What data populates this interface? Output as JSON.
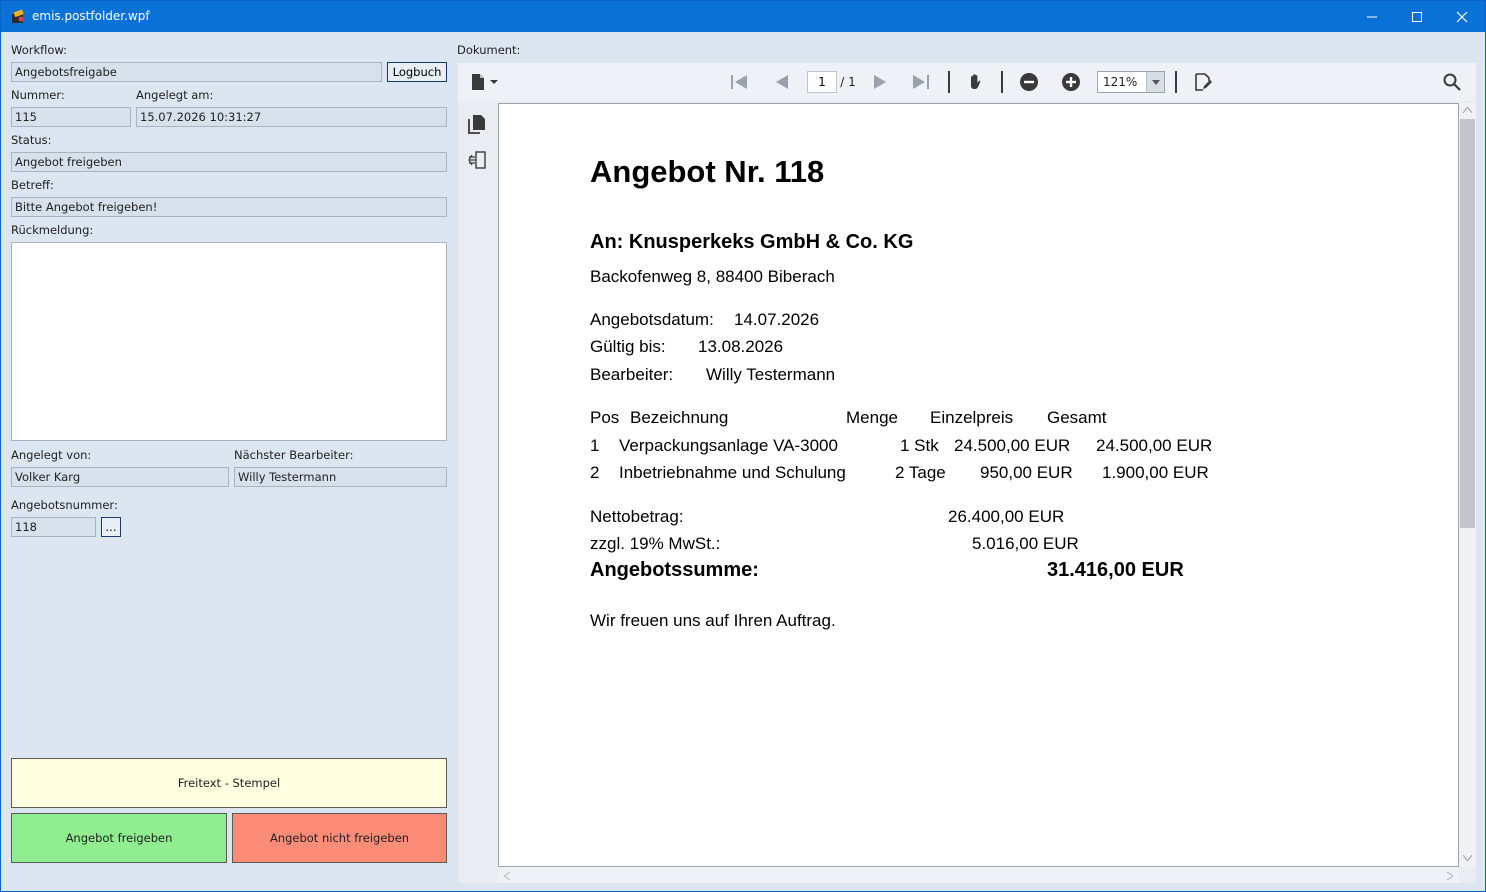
{
  "window": {
    "title": "emis.postfolder.wpf"
  },
  "form": {
    "workflow_label": "Workflow:",
    "workflow_value": "Angebotsfreigabe",
    "logbuch_button": "Logbuch",
    "nummer_label": "Nummer:",
    "nummer_value": "115",
    "angelegt_am_label": "Angelegt am:",
    "angelegt_am_value": "15.07.2026 10:31:27",
    "status_label": "Status:",
    "status_value": "Angebot freigeben",
    "betreff_label": "Betreff:",
    "betreff_value": "Bitte Angebot freigeben!",
    "rueckmeldung_label": "Rückmeldung:",
    "rueckmeldung_value": "",
    "angelegt_von_label": "Angelegt von:",
    "angelegt_von_value": "Volker Karg",
    "naechster_label": "Nächster Bearbeiter:",
    "naechster_value": "Willy Testermann",
    "angebotsnummer_label": "Angebotsnummer:",
    "angebotsnummer_value": "118",
    "browse_button": "..."
  },
  "buttons": {
    "freitext": "Freitext - Stempel",
    "freigeben": "Angebot freigeben",
    "nicht_freigeben": "Angebot nicht freigeben"
  },
  "viewer": {
    "label": "Dokument:",
    "page_current": "1",
    "page_total": "/ 1",
    "zoom": "121%"
  },
  "document": {
    "title": "Angebot Nr. 118",
    "recipient": "An: Knusperkeks GmbH & Co. KG",
    "address": "Backofenweg 8, 88400 Biberach",
    "datum_label": "Angebotsdatum:",
    "datum_value": "14.07.2026",
    "gueltig_label": "Gültig bis:",
    "gueltig_value": "13.08.2026",
    "bearbeiter_label": "Bearbeiter:",
    "bearbeiter_value": "Willy Testermann",
    "table_header": {
      "pos": "Pos",
      "bezeichnung": "Bezeichnung",
      "menge": "Menge",
      "einzelpreis": "Einzelpreis",
      "gesamt": "Gesamt"
    },
    "rows": [
      {
        "pos": "1",
        "bezeichnung": "Verpackungsanlage VA-3000",
        "menge": "1 Stk",
        "einzelpreis": "24.500,00 EUR",
        "gesamt": "24.500,00 EUR"
      },
      {
        "pos": "2",
        "bezeichnung": "Inbetriebnahme und Schulung",
        "menge": "2 Tage",
        "einzelpreis": "950,00 EUR",
        "gesamt": "1.900,00 EUR"
      }
    ],
    "netto_label": "Nettobetrag:",
    "netto_value": "26.400,00 EUR",
    "mwst_label": "zzgl. 19% MwSt.:",
    "mwst_value": "5.016,00 EUR",
    "summe_label": "Angebotssumme:",
    "summe_value": "31.416,00 EUR",
    "closing": "Wir freuen uns auf Ihren Auftrag."
  },
  "colors": {
    "titlebar": "#0a72d6",
    "panel": "#dbe6f1",
    "freitext_bg": "#ffffe0",
    "approve_bg": "#90ee90",
    "reject_bg": "#fa8c78"
  }
}
